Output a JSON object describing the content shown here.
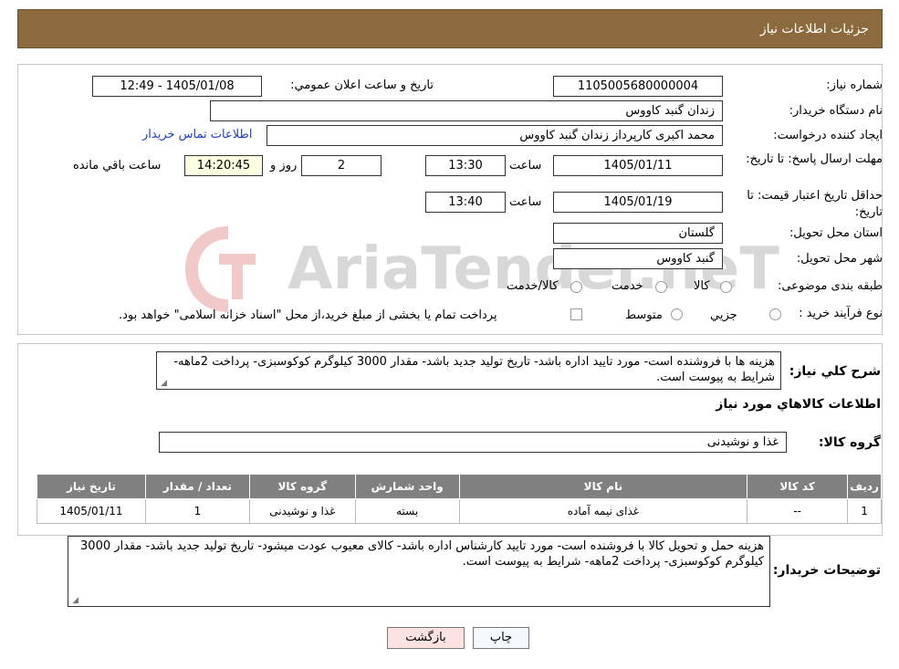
{
  "header": {
    "title": "جزئیات اطلاعات نیاز"
  },
  "watermark": {
    "text": "AriaTender.neT"
  },
  "form": {
    "need_number_label": "شماره نیاز:",
    "need_number": "1105005680000004",
    "announce_label": "تاریخ و ساعت اعلان عمومي:",
    "announce_value": "1405/01/08 - 12:49",
    "buyer_org_label": "نام دستگاه خریدار:",
    "buyer_org": "زندان گنبد کاووس",
    "creator_label": "ایجاد کننده درخواست:",
    "creator": "محمد اکبری کارپرداز زندان گنبد کاووس",
    "contact_link": "اطلاعات تماس خریدار",
    "reply_deadline_label": "مهلت ارسال پاسخ: تا تاریخ:",
    "reply_date": "1405/01/11",
    "time_label": "ساعت",
    "reply_time": "13:30",
    "days_value": "2",
    "days_label": "روز و",
    "remaining_time": "14:20:45",
    "remaining_label": "ساعت باقي مانده",
    "price_validity_label": "حداقل تاریخ اعتبار قیمت: تا تاریخ:",
    "price_date": "1405/01/19",
    "price_time": "13:40",
    "province_label": "استان محل تحویل:",
    "province": "گلستان",
    "city_label": "شهر محل تحویل:",
    "city": "گنبد کاووس",
    "category_label": "طبقه بندی موضوعی:",
    "category_options": [
      "کالا",
      "خدمت",
      "کالا/خدمت"
    ],
    "process_label": "نوع فرآیند خرید :",
    "process_options": [
      "جزيي",
      "متوسط"
    ],
    "process_note": "پرداخت تمام یا بخشی از مبلغ خرید،از محل \"اسناد خزانه اسلامی\" خواهد بود."
  },
  "summary": {
    "label": "شرح كلي نياز:",
    "text": "هزینه ها با فروشنده است- مورد تایید اداره باشد- تاریخ تولید جدید باشد- مقدار 3000 کیلوگرم کوکوسبزی- پرداخت 2ماهه- شرایط به پیوست است."
  },
  "goods": {
    "section_title": "اطلاعات كالاهاي مورد نياز",
    "group_label": "گروه کالا:",
    "group_value": "غذا و نوشیدنی",
    "columns": [
      "ردیف",
      "کد کالا",
      "نام کالا",
      "واحد شمارش",
      "گروه کالا",
      "تعداد / مقدار",
      "تاریخ نیاز"
    ],
    "rows": [
      [
        "1",
        "--",
        "غذای نیمه آماده",
        "بسته",
        "غذا و نوشیدنی",
        "1",
        "1405/01/11"
      ]
    ]
  },
  "buyer_notes": {
    "label": "توضیحات خریدار:",
    "text": "هزینه حمل و تحویل کالا با فروشنده است- مورد تایید کارشناس اداره باشد- کالای معیوب عودت میشود- تاریخ تولید جدید باشد- مقدار 3000 کیلوگرم کوکوسبزی- پرداخت 2ماهه- شرایط به پیوست است."
  },
  "buttons": {
    "print": "چاپ",
    "back": "بازگشت"
  }
}
